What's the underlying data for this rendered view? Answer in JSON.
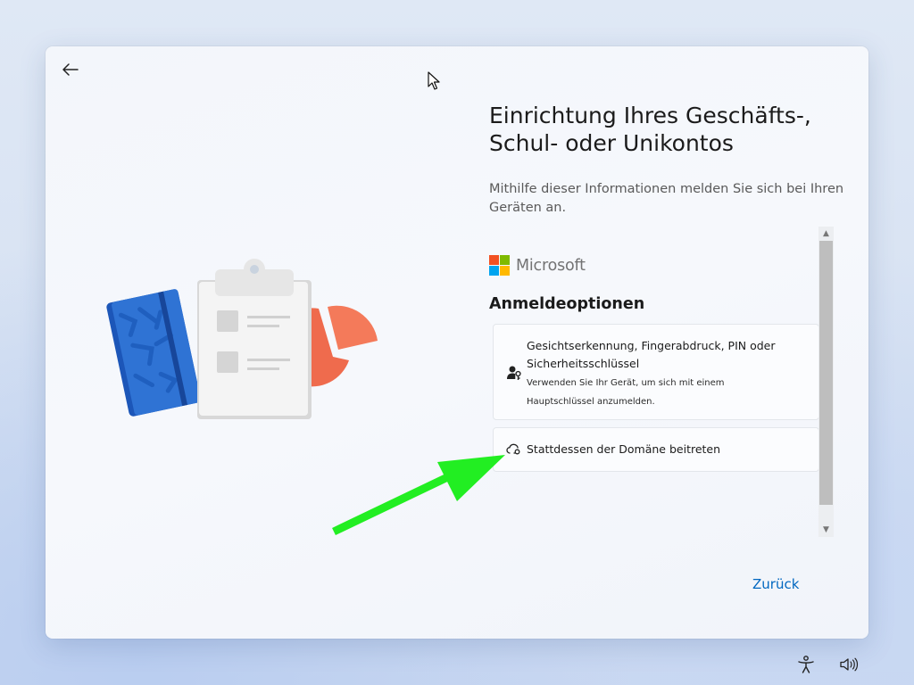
{
  "page": {
    "title": "Einrichtung Ihres Geschäfts-, Schul- oder Unikontos",
    "subtitle": "Mithilfe dieser Informationen melden Sie sich bei Ihren Geräten an."
  },
  "brand": {
    "name": "Microsoft",
    "colors": [
      "#f25022",
      "#7fba00",
      "#00a4ef",
      "#ffb900"
    ]
  },
  "signin": {
    "section_title": "Anmeldeoptionen",
    "options": [
      {
        "title": "Gesichtserkennung, Fingerabdruck, PIN oder Sicherheitsschlüssel",
        "description": "Verwenden Sie Ihr Gerät, um sich mit einem Hauptschlüssel anzumelden.",
        "icon": "user-key-icon"
      },
      {
        "title": "Stattdessen der Domäne beitreten",
        "icon": "cloud-key-icon"
      }
    ]
  },
  "footer": {
    "back_label": "Zurück"
  },
  "colors": {
    "accent": "#0067c0",
    "annotation_arrow": "#22ee22"
  }
}
